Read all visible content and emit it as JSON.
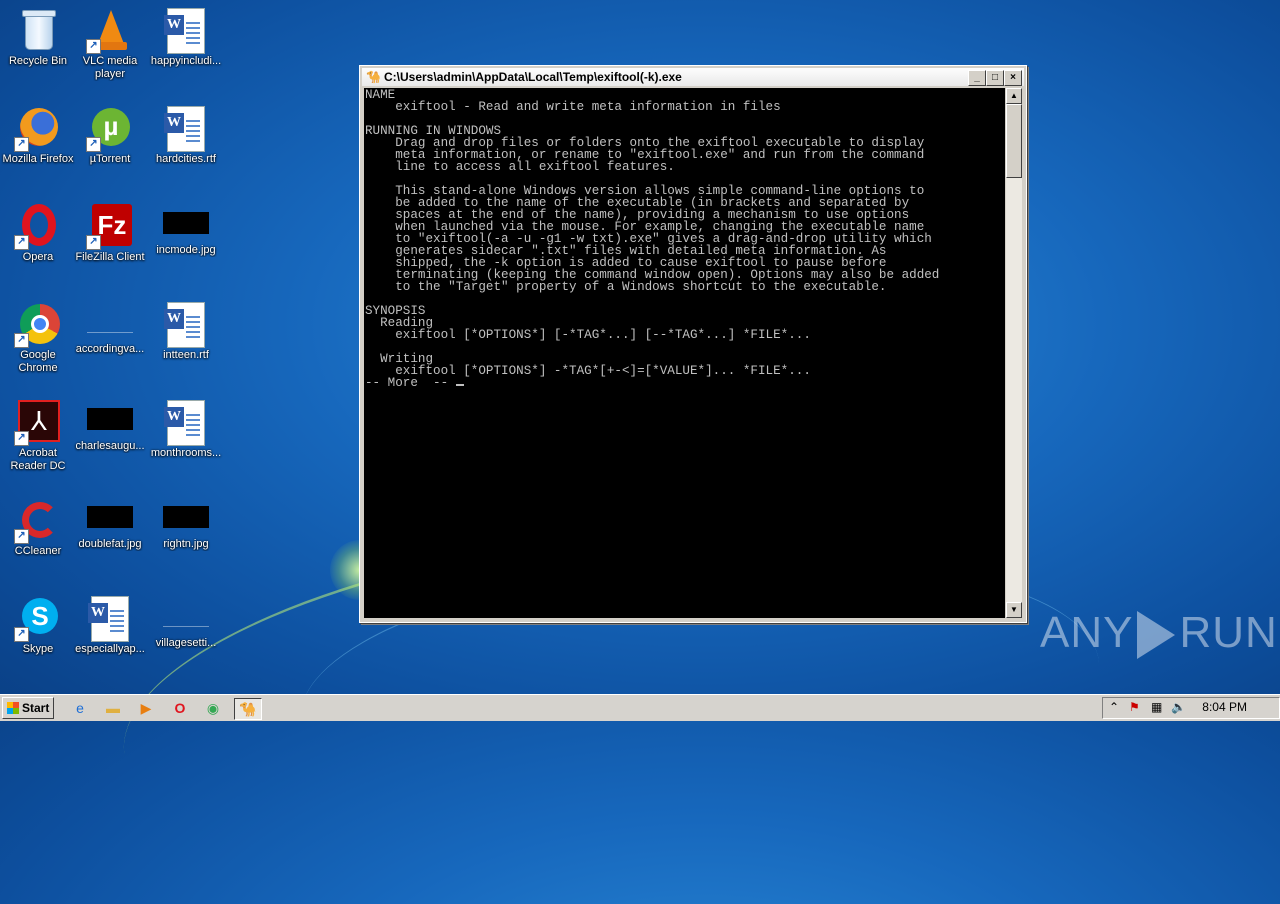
{
  "desktop": {
    "icons": [
      {
        "label": "Recycle Bin"
      },
      {
        "label": "VLC media player"
      },
      {
        "label": "happyincludi..."
      },
      {
        "label": "Mozilla Firefox"
      },
      {
        "label": "µTorrent"
      },
      {
        "label": "hardcities.rtf"
      },
      {
        "label": "Opera"
      },
      {
        "label": "FileZilla Client"
      },
      {
        "label": "incmode.jpg"
      },
      {
        "label": "Google Chrome"
      },
      {
        "label": "accordingva..."
      },
      {
        "label": "intteen.rtf"
      },
      {
        "label": "Acrobat Reader DC"
      },
      {
        "label": "charlesaugu..."
      },
      {
        "label": "monthrooms..."
      },
      {
        "label": "CCleaner"
      },
      {
        "label": "doublefat.jpg"
      },
      {
        "label": "rightn.jpg"
      },
      {
        "label": "Skype"
      },
      {
        "label": "especiallyap..."
      },
      {
        "label": "villagesetti..."
      }
    ]
  },
  "window": {
    "title": "C:\\Users\\admin\\AppData\\Local\\Temp\\exiftool(-k).exe",
    "minimize": "_",
    "maximize": "□",
    "close": "×",
    "console_text": "NAME\n    exiftool - Read and write meta information in files\n\nRUNNING IN WINDOWS\n    Drag and drop files or folders onto the exiftool executable to display\n    meta information, or rename to \"exiftool.exe\" and run from the command\n    line to access all exiftool features.\n\n    This stand-alone Windows version allows simple command-line options to\n    be added to the name of the executable (in brackets and separated by\n    spaces at the end of the name), providing a mechanism to use options\n    when launched via the mouse. For example, changing the executable name\n    to \"exiftool(-a -u -g1 -w txt).exe\" gives a drag-and-drop utility which\n    generates sidecar \".txt\" files with detailed meta information. As\n    shipped, the -k option is added to cause exiftool to pause before\n    terminating (keeping the command window open). Options may also be added\n    to the \"Target\" property of a Windows shortcut to the executable.\n\nSYNOPSIS\n  Reading\n    exiftool [*OPTIONS*] [-*TAG*...] [--*TAG*...] *FILE*...\n\n  Writing\n    exiftool [*OPTIONS*] -*TAG*[+-<]=[*VALUE*]... *FILE*...\n-- More  -- "
  },
  "watermark": {
    "left": "ANY",
    "right": "RUN"
  },
  "taskbar": {
    "start_label": "Start",
    "clock": "8:04 PM"
  }
}
